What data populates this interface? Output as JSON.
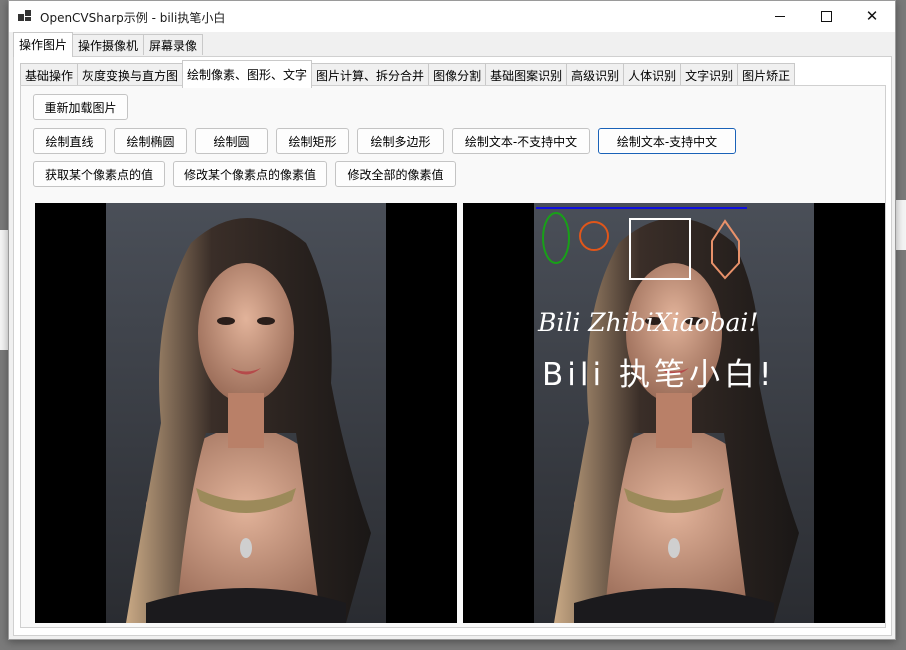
{
  "window": {
    "title": "OpenCVSharp示例 - bili执笔小白"
  },
  "main_tabs": [
    {
      "label": "操作图片",
      "active": true
    },
    {
      "label": "操作摄像机",
      "active": false
    },
    {
      "label": "屏幕录像",
      "active": false
    }
  ],
  "sub_tabs": [
    {
      "label": "基础操作",
      "active": false
    },
    {
      "label": "灰度变换与直方图",
      "active": false
    },
    {
      "label": "绘制像素、图形、文字",
      "active": true
    },
    {
      "label": "图片计算、拆分合并",
      "active": false
    },
    {
      "label": "图像分割",
      "active": false
    },
    {
      "label": "基础图案识别",
      "active": false
    },
    {
      "label": "高级识别",
      "active": false
    },
    {
      "label": "人体识别",
      "active": false
    },
    {
      "label": "文字识别",
      "active": false
    },
    {
      "label": "图片矫正",
      "active": false
    }
  ],
  "buttons": {
    "reload": "重新加载图片",
    "draw_line": "绘制直线",
    "draw_ellipse": "绘制椭圆",
    "draw_circle": "绘制圆",
    "draw_rect": "绘制矩形",
    "draw_polygon": "绘制多边形",
    "draw_text_no_cn": "绘制文本-不支持中文",
    "draw_text_cn": "绘制文本-支持中文",
    "get_pixel": "获取某个像素点的值",
    "set_pixel": "修改某个像素点的像素值",
    "set_all_pixels": "修改全部的像素值"
  },
  "result_image": {
    "text_latin": "Bili ZhibiXiaobai!",
    "text_cn": "Bili 执笔小白!",
    "colors": {
      "line": "#1010e0",
      "ellipse": "#18a018",
      "circle": "#e0561a",
      "rect": "#ffffff",
      "polygon": "#e8916a",
      "text": "#ffffff"
    }
  },
  "icons": {
    "app": "app-icon",
    "minimize": "minimize-icon",
    "maximize": "maximize-icon",
    "close": "close-icon"
  }
}
